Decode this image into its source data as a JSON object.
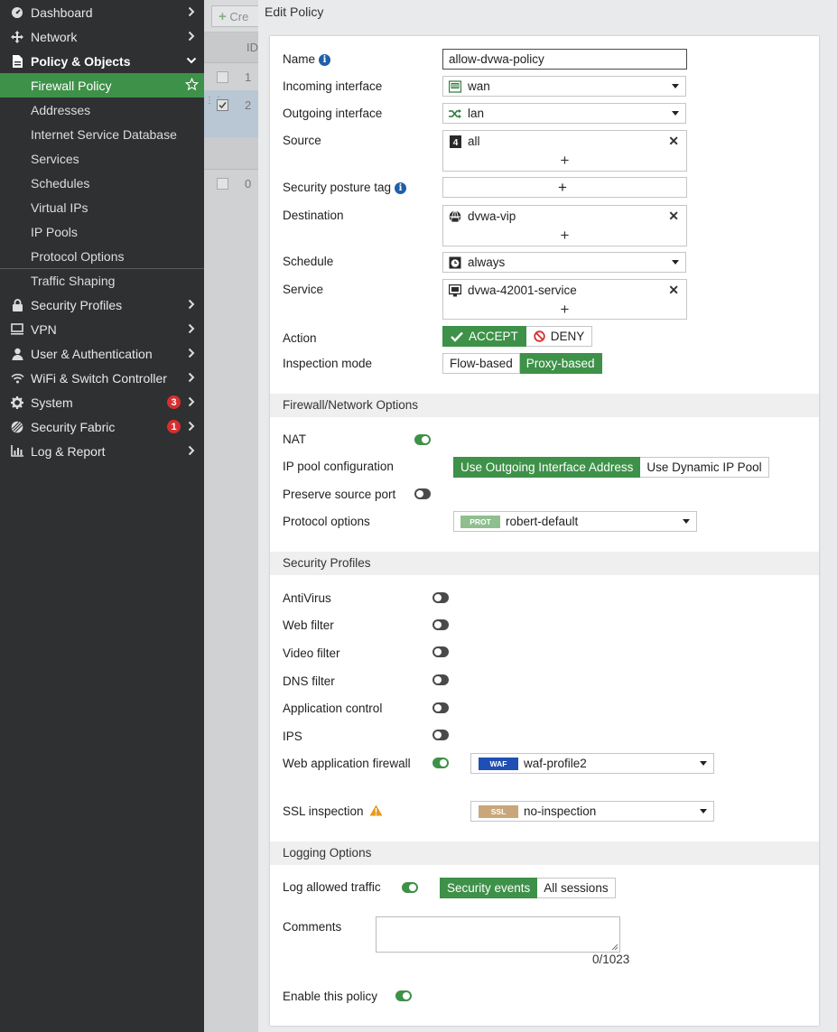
{
  "sidebar": {
    "items": [
      {
        "label": "Dashboard",
        "icon": "dashboard-icon"
      },
      {
        "label": "Network",
        "icon": "network-icon"
      },
      {
        "label": "Policy & Objects",
        "icon": "policy-icon"
      }
    ],
    "policy_sub": [
      {
        "label": "Firewall Policy"
      },
      {
        "label": "Addresses"
      },
      {
        "label": "Internet Service Database"
      },
      {
        "label": "Services"
      },
      {
        "label": "Schedules"
      },
      {
        "label": "Virtual IPs"
      },
      {
        "label": "IP Pools"
      },
      {
        "label": "Protocol Options"
      },
      {
        "label": "Traffic Shaping"
      }
    ],
    "rest": [
      {
        "label": "Security Profiles",
        "icon": "lock-icon"
      },
      {
        "label": "VPN",
        "icon": "monitor-icon"
      },
      {
        "label": "User & Authentication",
        "icon": "user-icon"
      },
      {
        "label": "WiFi & Switch Controller",
        "icon": "wifi-icon"
      },
      {
        "label": "System",
        "icon": "gear-icon",
        "badge": "3"
      },
      {
        "label": "Security Fabric",
        "icon": "fabric-icon",
        "badge": "1"
      },
      {
        "label": "Log & Report",
        "icon": "chart-icon"
      }
    ]
  },
  "background": {
    "create_label": "Cre",
    "id_header": "ID",
    "rows": [
      "1",
      "2",
      "0"
    ]
  },
  "dialog": {
    "title": "Edit Policy",
    "name_label": "Name",
    "name_value": "allow-dvwa-policy",
    "incoming_label": "Incoming interface",
    "incoming_value": "wan",
    "outgoing_label": "Outgoing interface",
    "outgoing_value": "lan",
    "source_label": "Source",
    "source_value": "all",
    "posture_label": "Security posture tag",
    "destination_label": "Destination",
    "destination_value": "dvwa-vip",
    "schedule_label": "Schedule",
    "schedule_value": "always",
    "service_label": "Service",
    "service_value": "dvwa-42001-service",
    "action_label": "Action",
    "action_accept": "ACCEPT",
    "action_deny": "DENY",
    "inspection_label": "Inspection mode",
    "inspection_flow": "Flow-based",
    "inspection_proxy": "Proxy-based"
  },
  "firewall_options": {
    "header": "Firewall/Network Options",
    "nat_label": "NAT",
    "ippool_label": "IP pool configuration",
    "ippool_outgoing": "Use Outgoing Interface Address",
    "ippool_dynamic": "Use Dynamic IP Pool",
    "preserve_label": "Preserve source port",
    "protocol_label": "Protocol options",
    "protocol_tag": "PROT",
    "protocol_value": "robert-default"
  },
  "security_profiles": {
    "header": "Security Profiles",
    "antivirus": "AntiVirus",
    "webfilter": "Web filter",
    "videofilter": "Video filter",
    "dnsfilter": "DNS filter",
    "appcontrol": "Application control",
    "ips": "IPS",
    "waf_label": "Web application firewall",
    "waf_tag": "WAF",
    "waf_value": "waf-profile2",
    "ssl_label": "SSL inspection",
    "ssl_tag": "SSL",
    "ssl_value": "no-inspection"
  },
  "logging": {
    "header": "Logging Options",
    "log_label": "Log allowed traffic",
    "security_events": "Security events",
    "all_sessions": "All sessions",
    "comments_label": "Comments",
    "comments_counter": "0/1023",
    "enable_label": "Enable this policy"
  },
  "colors": {
    "accent": "#3e9148",
    "sidebar_bg": "#2f3032",
    "badge": "#d62f2f",
    "waf_tag": "#1f4fb5",
    "ssl_tag": "#c9a77a",
    "prot_tag": "#8fbf8f"
  }
}
